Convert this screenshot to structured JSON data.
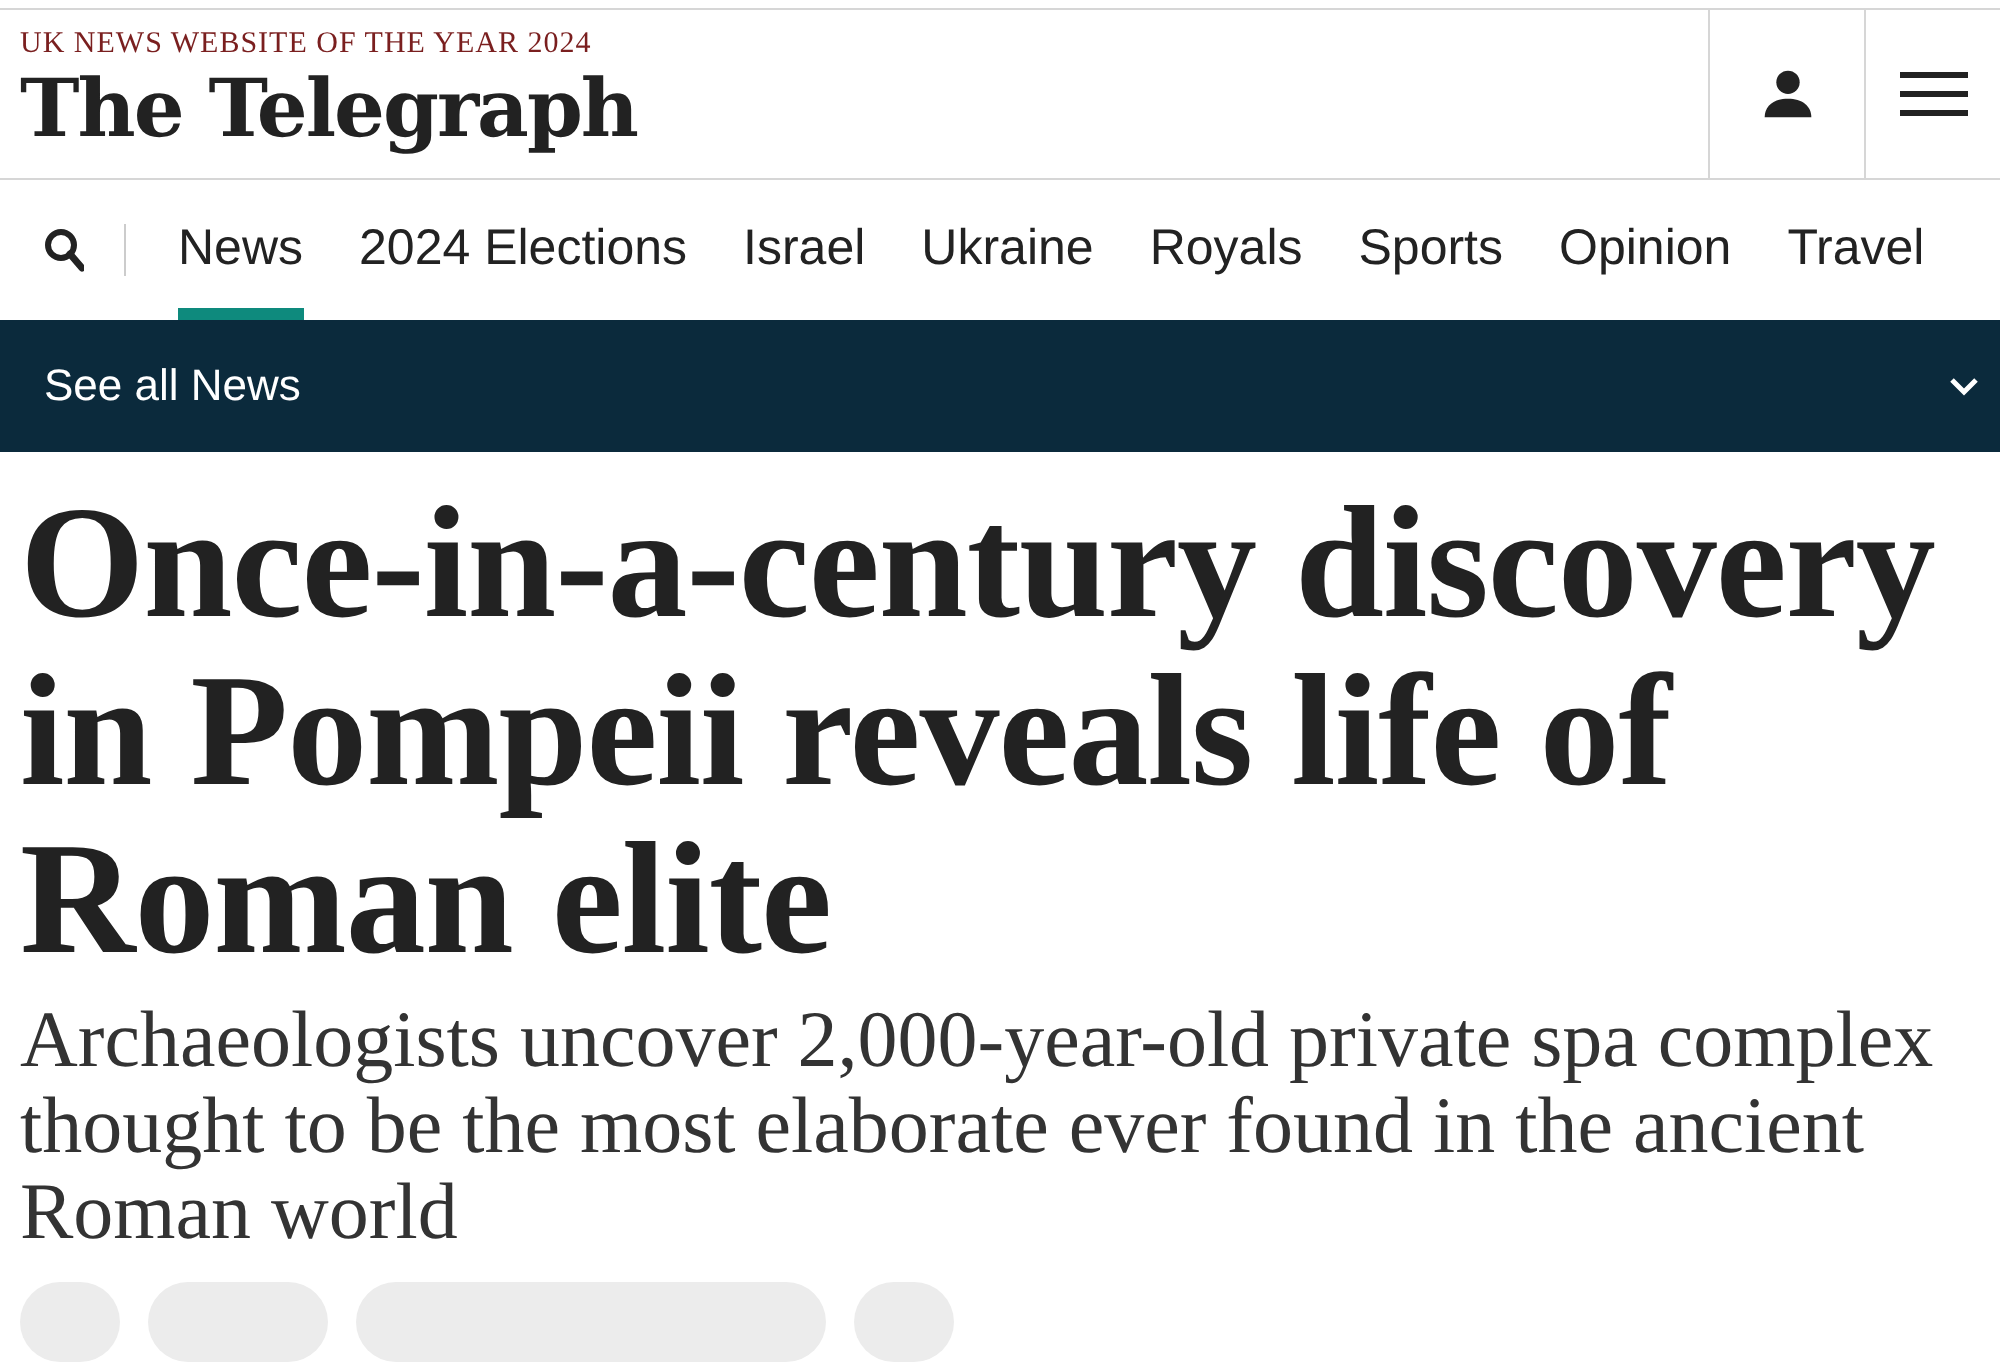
{
  "header": {
    "award": "UK NEWS WEBSITE OF THE YEAR 2024",
    "logo": "The Telegraph"
  },
  "nav": {
    "items": [
      {
        "label": "News",
        "selected": true
      },
      {
        "label": "2024 Elections",
        "selected": false
      },
      {
        "label": "Israel",
        "selected": false
      },
      {
        "label": "Ukraine",
        "selected": false
      },
      {
        "label": "Royals",
        "selected": false
      },
      {
        "label": "Sports",
        "selected": false
      },
      {
        "label": "Opinion",
        "selected": false
      },
      {
        "label": "Travel",
        "selected": false
      }
    ]
  },
  "section_bar": {
    "label": "See all News",
    "expanded": false
  },
  "article": {
    "headline": "Once-in-a-century discovery in Pompeii reveals life of Roman elite",
    "standfirst": "Archaeologists uncover 2,000-year-old private spa complex thought to be the most elaborate ever found in the ancient Roman world"
  }
}
